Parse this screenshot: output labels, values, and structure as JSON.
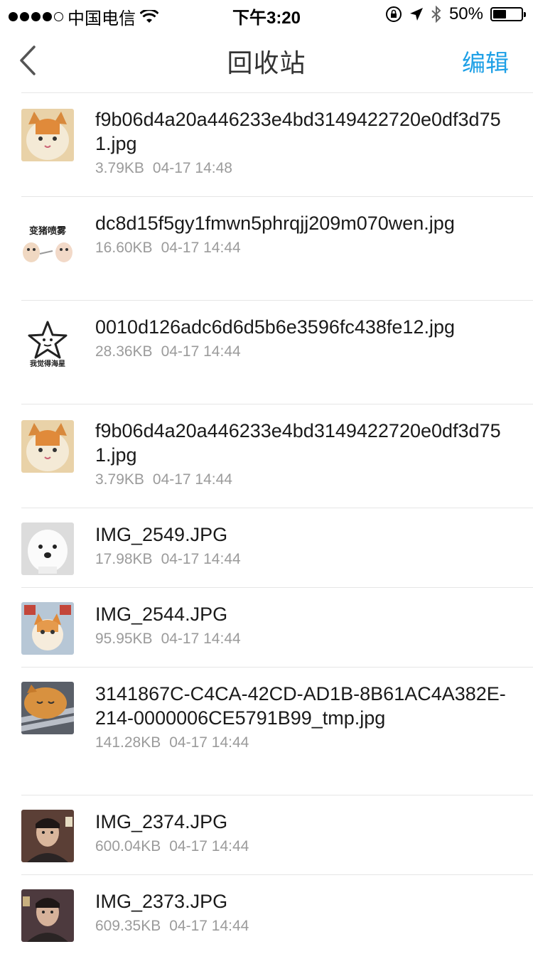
{
  "status": {
    "carrier": "中国电信",
    "time": "下午3:20",
    "battery": "50%",
    "battery_level": 0.5
  },
  "nav": {
    "title": "回收站",
    "edit_label": "编辑",
    "accent_color": "#1ea0e6"
  },
  "items": [
    {
      "name": "f9b06d4a20a446233e4bd3149422720e0df3d751.jpg",
      "size": "3.79KB",
      "time": "04-17 14:48",
      "thumb_icon": "cat-meme-icon"
    },
    {
      "name": "dc8d15f5gy1fmwn5phrqjj209m070wen.jpg",
      "size": "16.60KB",
      "time": "04-17 14:44",
      "thumb_icon": "sticker-text-icon",
      "thumb_text": "变猪喷雾"
    },
    {
      "name": "0010d126adc6d6d5b6e3596fc438fe12.jpg",
      "size": "28.36KB",
      "time": "04-17 14:44",
      "thumb_icon": "starfish-meme-icon",
      "thumb_text": "我觉得海星"
    },
    {
      "name": "f9b06d4a20a446233e4bd3149422720e0df3d751.jpg",
      "size": "3.79KB",
      "time": "04-17 14:44",
      "thumb_icon": "cat-meme-icon"
    },
    {
      "name": "IMG_2549.JPG",
      "size": "17.98KB",
      "time": "04-17 14:44",
      "thumb_icon": "dog-meme-icon"
    },
    {
      "name": "IMG_2544.JPG",
      "size": "95.95KB",
      "time": "04-17 14:44",
      "thumb_icon": "cat-meme-icon"
    },
    {
      "name": "3141867C-C4CA-42CD-AD1B-8B61AC4A382E-214-0000006CE5791B99_tmp.jpg",
      "size": "141.28KB",
      "time": "04-17 14:44",
      "thumb_icon": "sleeping-cat-icon"
    },
    {
      "name": "IMG_2374.JPG",
      "size": "600.04KB",
      "time": "04-17 14:44",
      "thumb_icon": "portrait-icon"
    },
    {
      "name": "IMG_2373.JPG",
      "size": "609.35KB",
      "time": "04-17 14:44",
      "thumb_icon": "portrait-icon"
    }
  ]
}
